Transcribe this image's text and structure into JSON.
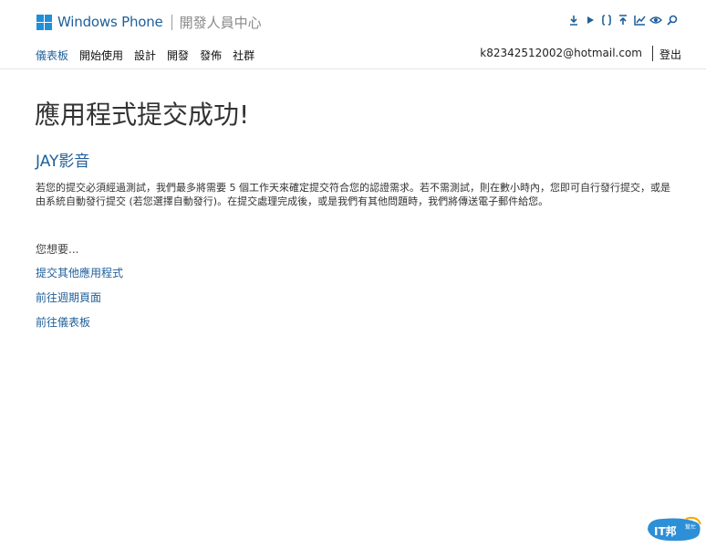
{
  "header": {
    "brand_name": "Windows Phone",
    "brand_sub": "開發人員中心",
    "icons": [
      "download-icon",
      "play-icon",
      "code-braces-icon",
      "upload-icon",
      "chart-icon",
      "eye-icon",
      "search-icon"
    ]
  },
  "nav": {
    "items": [
      "儀表板",
      "開始使用",
      "設計",
      "開發",
      "發佈",
      "社群"
    ],
    "active": "儀表板"
  },
  "account": {
    "email": "k82342512002@hotmail.com",
    "signout": "登出"
  },
  "main": {
    "title": "應用程式提交成功!",
    "app_name": "JAY影音",
    "description": "若您的提交必須經過測試，我們最多將需要 5 個工作天來確定提交符合您的認證需求。若不需測試，則在數小時內，您即可自行發行提交，或是由系統自動發行提交 (若您選擇自動發行)。在提交處理完成後，或是我們有其他問題時，我們將傳送電子郵件給您。",
    "want_label": "您想要...",
    "links": [
      "提交其他應用程式",
      "前往週期頁面",
      "前往儀表板"
    ]
  },
  "watermark": {
    "text": "IT邦",
    "subtext": "幫忙"
  },
  "colors": {
    "accent": "#1f5f9a",
    "logo_blue": "#1f8fd9"
  }
}
